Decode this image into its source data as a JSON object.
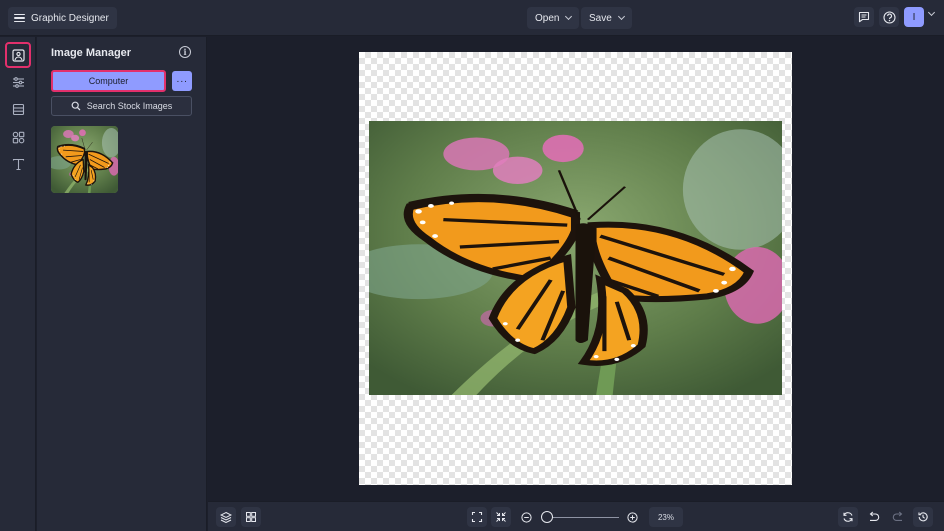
{
  "topbar": {
    "app_title": "Graphic Designer",
    "open_label": "Open",
    "save_label": "Save",
    "user_initial": "I"
  },
  "rail": {
    "items": [
      "image-manager",
      "adjustments",
      "layout",
      "elements",
      "text"
    ],
    "active": "image-manager"
  },
  "panel": {
    "title": "Image Manager",
    "computer_label": "Computer",
    "more_label": "···",
    "search_label": "Search Stock Images"
  },
  "bottombar": {
    "zoom_level": "23%",
    "zoom_fraction": 0.02
  },
  "colors": {
    "accent": "#8f9bff",
    "highlight": "#e2306c",
    "panel_bg": "#262a38",
    "workspace_bg": "#1c1f2b"
  }
}
